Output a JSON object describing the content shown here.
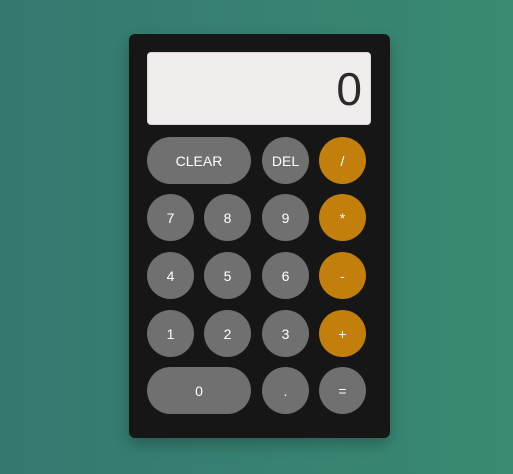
{
  "display": {
    "value": "0"
  },
  "buttons": {
    "clear": "CLEAR",
    "del": "DEL",
    "divide": "/",
    "multiply": "*",
    "subtract": "-",
    "add": "+",
    "equals": "=",
    "decimal": ".",
    "digits": {
      "d0": "0",
      "d1": "1",
      "d2": "2",
      "d3": "3",
      "d4": "4",
      "d5": "5",
      "d6": "6",
      "d7": "7",
      "d8": "8",
      "d9": "9"
    }
  },
  "colors": {
    "background_start": "#357870",
    "background_end": "#398a72",
    "panel": "#161616",
    "display": "#f1eded",
    "key": "#707070",
    "operator_key": "#c37f0b",
    "key_text": "#ffffff"
  }
}
